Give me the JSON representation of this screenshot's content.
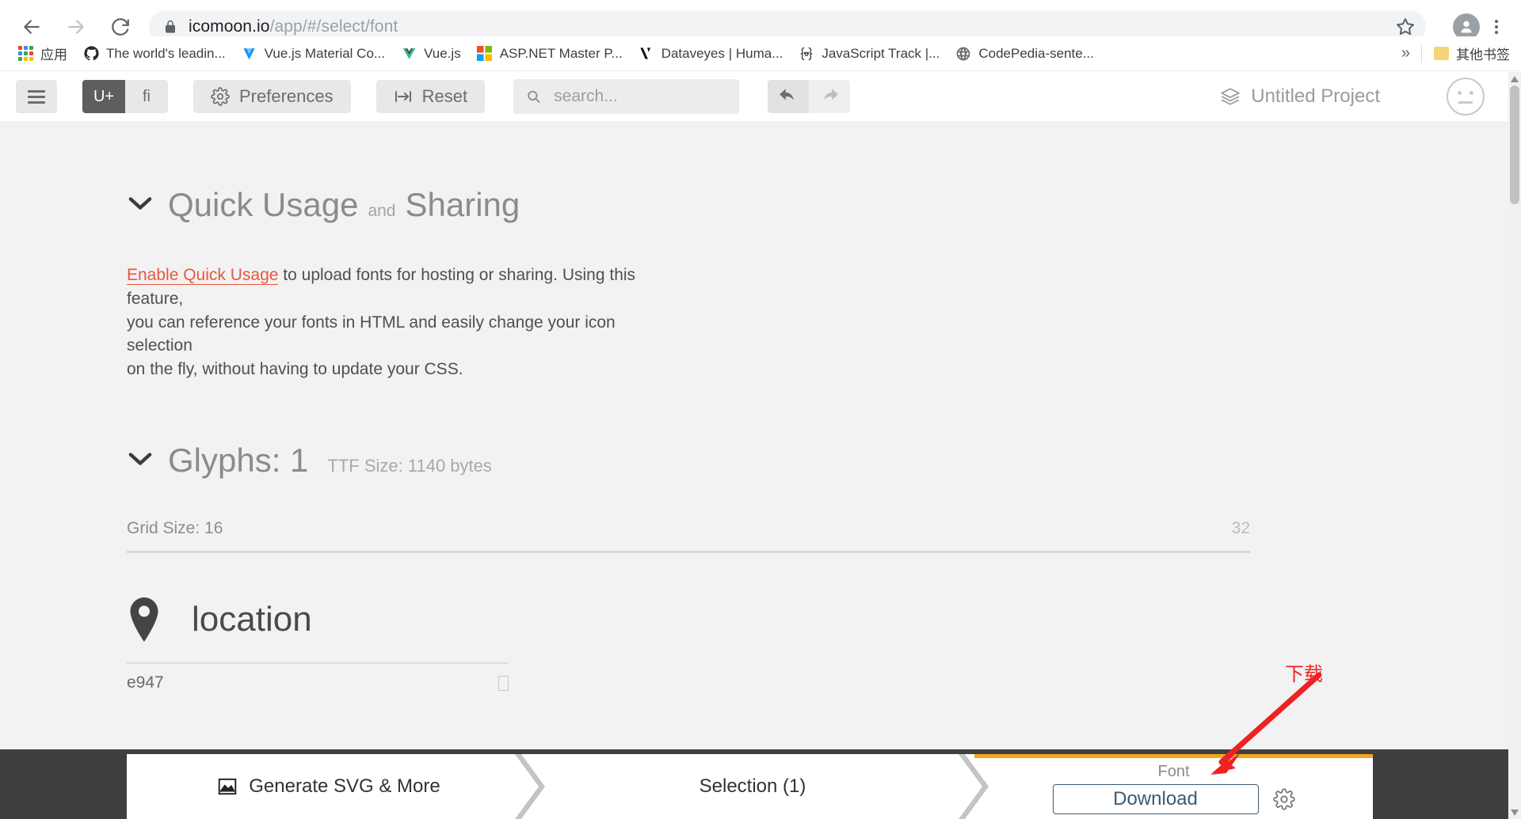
{
  "browser": {
    "back_icon": "back-arrow-icon",
    "forward_icon": "forward-arrow-icon",
    "reload_icon": "reload-icon",
    "lock_icon": "lock-icon",
    "url_host": "icomoon.io",
    "url_path": "/app/#/select/font",
    "star_icon": "bookmark-star-icon",
    "profile_icon": "profile-avatar-icon",
    "menu_icon": "three-dot-menu-icon",
    "bookmarks": [
      {
        "label": "应用",
        "icon": "apps-grid-icon"
      },
      {
        "label": "The world's leadin...",
        "icon": "github-icon"
      },
      {
        "label": "Vue.js Material Co...",
        "icon": "vuetify-icon"
      },
      {
        "label": "Vue.js",
        "icon": "vue-icon"
      },
      {
        "label": "ASP.NET Master P...",
        "icon": "microsoft-icon"
      },
      {
        "label": "Dataveyes | Huma...",
        "icon": "dataveyes-icon"
      },
      {
        "label": "JavaScript Track |...",
        "icon": "exercism-icon"
      },
      {
        "label": "CodePedia-sente...",
        "icon": "globe-icon"
      }
    ],
    "overflow_label": "»",
    "other_bookmarks_label": "其他书签",
    "other_bookmarks_icon": "folder-icon"
  },
  "toolbar": {
    "menu_icon": "hamburger-menu-icon",
    "seg_unicode_label": "U+",
    "seg_ligature_label": "fi",
    "preferences_label": "Preferences",
    "preferences_icon": "gear-icon",
    "reset_label": "Reset",
    "reset_icon": "reset-icon",
    "search_placeholder": "search...",
    "search_value": "",
    "search_icon": "search-icon",
    "undo_icon": "undo-arrow-icon",
    "redo_icon": "redo-arrow-icon",
    "project_name": "Untitled Project",
    "project_icon": "layers-icon",
    "account_icon": "neutral-face-icon"
  },
  "quick_usage": {
    "chevron_icon": "chevron-down-icon",
    "title": "Quick Usage",
    "conjunction": "and",
    "title2": "Sharing",
    "link_label": "Enable Quick Usage",
    "body_line1": " to upload fonts for hosting or sharing. Using this feature,",
    "body_line2": "you can reference your fonts in HTML and easily change your icon selection",
    "body_line3": "on the fly, without having to update your CSS."
  },
  "glyphs": {
    "chevron_icon": "chevron-down-icon",
    "title": "Glyphs: 1",
    "ttf_size": "TTF Size: 1140 bytes",
    "grid_size_label": "Grid Size: 16",
    "grid_size_max": "32",
    "items": [
      {
        "icon": "location-pin-icon",
        "name": "location",
        "code": "e947",
        "preview_glyph": "tofu-box-icon"
      }
    ]
  },
  "footer": {
    "tabs": [
      {
        "label": "Generate SVG & More",
        "icon": "image-icon"
      },
      {
        "label": "Selection (1)",
        "icon": ""
      },
      {
        "label": "Font",
        "icon": ""
      }
    ],
    "download_label": "Download",
    "settings_icon": "gear-icon",
    "accent_color": "#f5a623"
  },
  "annotation": {
    "text": "下载",
    "color": "#ee2222",
    "icon": "red-arrow-annotation"
  },
  "scrollbar": {
    "up_icon": "scroll-up-arrow-icon",
    "down_icon": "scroll-down-arrow-icon"
  }
}
